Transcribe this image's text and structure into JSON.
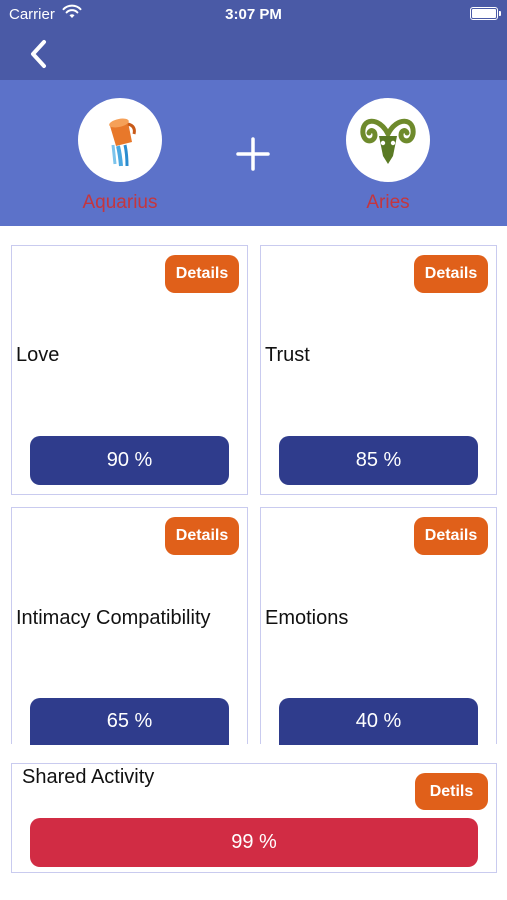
{
  "status_bar": {
    "carrier": "Carrier",
    "time": "3:07 PM"
  },
  "header": {
    "sign_left": {
      "name": "Aquarius",
      "icon": "aquarius-icon"
    },
    "sign_right": {
      "name": "Aries",
      "icon": "aries-icon"
    }
  },
  "cards": [
    {
      "title": "Love",
      "details_label": "Details",
      "percent": "90 %"
    },
    {
      "title": "Trust",
      "details_label": "Details",
      "percent": "85 %"
    },
    {
      "title": "Intimacy Compatibility",
      "details_label": "Details",
      "percent": "65 %"
    },
    {
      "title": "Emotions",
      "details_label": "Details",
      "percent": "40 %"
    }
  ],
  "shared": {
    "title": "Shared Activity",
    "details_label": "Detils",
    "percent": "99 %"
  },
  "colors": {
    "nav": "#4a5aa6",
    "header": "#5c72c9",
    "sign_name": "#c4363e",
    "details": "#e0601a",
    "percent_bar": "#2f3c8c",
    "percent_bar_highlight": "#d12c44"
  }
}
